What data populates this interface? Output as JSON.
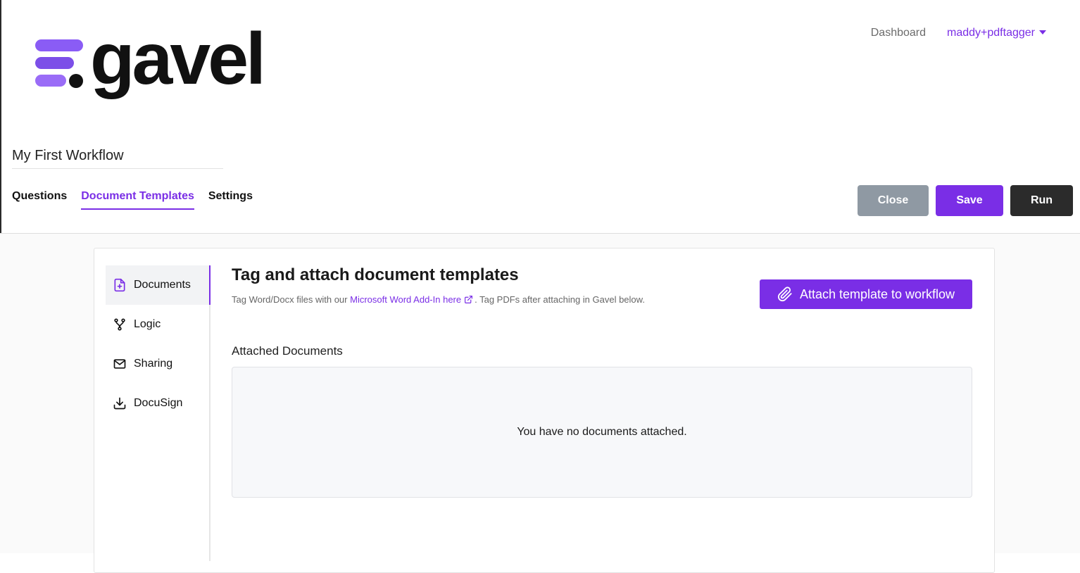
{
  "brand": {
    "name": "gavel",
    "accent": "#7a2ee6"
  },
  "top_nav": {
    "dashboard": "Dashboard",
    "user": "maddy+pdftagger"
  },
  "workflow": {
    "title": "My First Workflow"
  },
  "tabs": [
    {
      "label": "Questions",
      "active": false
    },
    {
      "label": "Document Templates",
      "active": true
    },
    {
      "label": "Settings",
      "active": false
    }
  ],
  "actions": {
    "close": "Close",
    "save": "Save",
    "run": "Run"
  },
  "sidenav": [
    {
      "label": "Documents",
      "icon": "file-plus-icon",
      "active": true
    },
    {
      "label": "Logic",
      "icon": "branch-icon",
      "active": false
    },
    {
      "label": "Sharing",
      "icon": "mail-icon",
      "active": false
    },
    {
      "label": "DocuSign",
      "icon": "download-icon",
      "active": false
    }
  ],
  "content": {
    "heading": "Tag and attach document templates",
    "sub_prefix": "Tag Word/Docx files with our ",
    "sub_link": "Microsoft Word Add-In here",
    "sub_suffix": ". Tag PDFs after attaching in Gavel below.",
    "attach_button": "Attach template to workflow",
    "attached_label": "Attached Documents",
    "empty_message": "You have no documents attached."
  }
}
